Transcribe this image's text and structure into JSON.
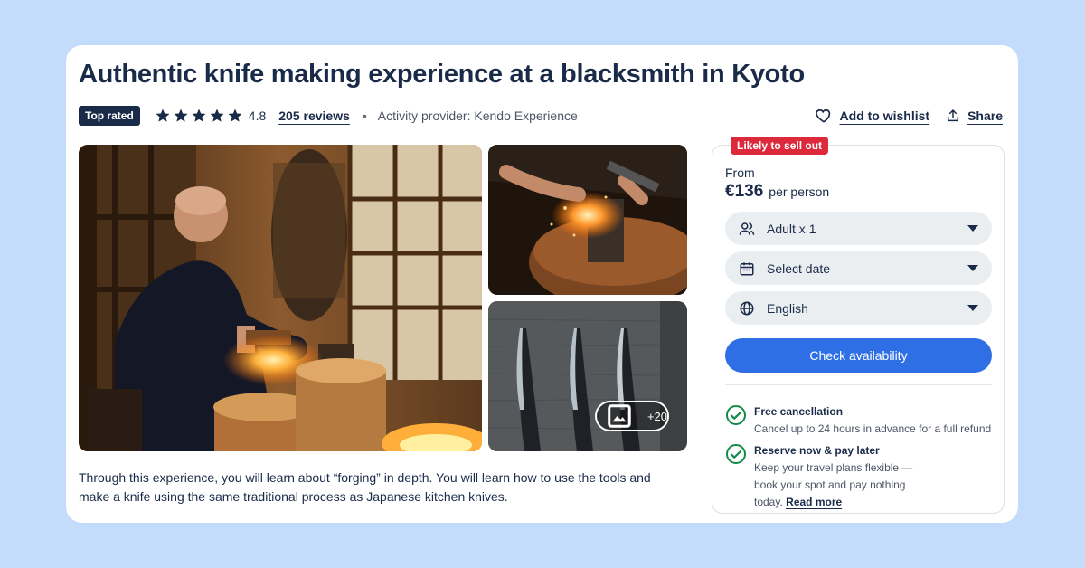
{
  "listing": {
    "title": "Authentic knife making experience at a blacksmith in Kyoto",
    "badge": "Top rated",
    "rating": "4.8",
    "stars": 5,
    "reviews_label": "205 reviews",
    "separator": "•",
    "provider": "Activity provider: Kendo Experience",
    "description": "Through this experience, you will learn about “forging” in depth. You will learn how to use the tools and make a knife using the same traditional process as Japanese kitchen knives."
  },
  "actions": {
    "wishlist_label": "Add to wishlist",
    "share_label": "Share"
  },
  "gallery": {
    "more_photos_label": "+20"
  },
  "booking": {
    "sellout_badge": "Likely to sell out",
    "from_label": "From",
    "price": "€136",
    "price_unit": "per person",
    "participants_value": "Adult x 1",
    "date_value": "Select date",
    "language_value": "English",
    "cta_label": "Check availability",
    "features": [
      {
        "title": "Free cancellation",
        "desc": "Cancel up to 24 hours in advance for a full refund"
      },
      {
        "title": "Reserve now & pay later",
        "desc": "Keep your travel plans flexible — book your spot and pay nothing today.",
        "link": "Read more"
      }
    ]
  },
  "colors": {
    "background": "#c3dcfb",
    "navy": "#1a2b49",
    "primary_button": "#2f6fe6",
    "sellout_red": "#dc2a3c",
    "check_green": "#148a4a",
    "select_bg": "#ebeef1"
  },
  "icons": [
    "star-icon",
    "heart-icon",
    "share-icon",
    "gallery-icon",
    "users-icon",
    "calendar-icon",
    "globe-icon",
    "chevron-down-icon",
    "check-circle-icon"
  ]
}
